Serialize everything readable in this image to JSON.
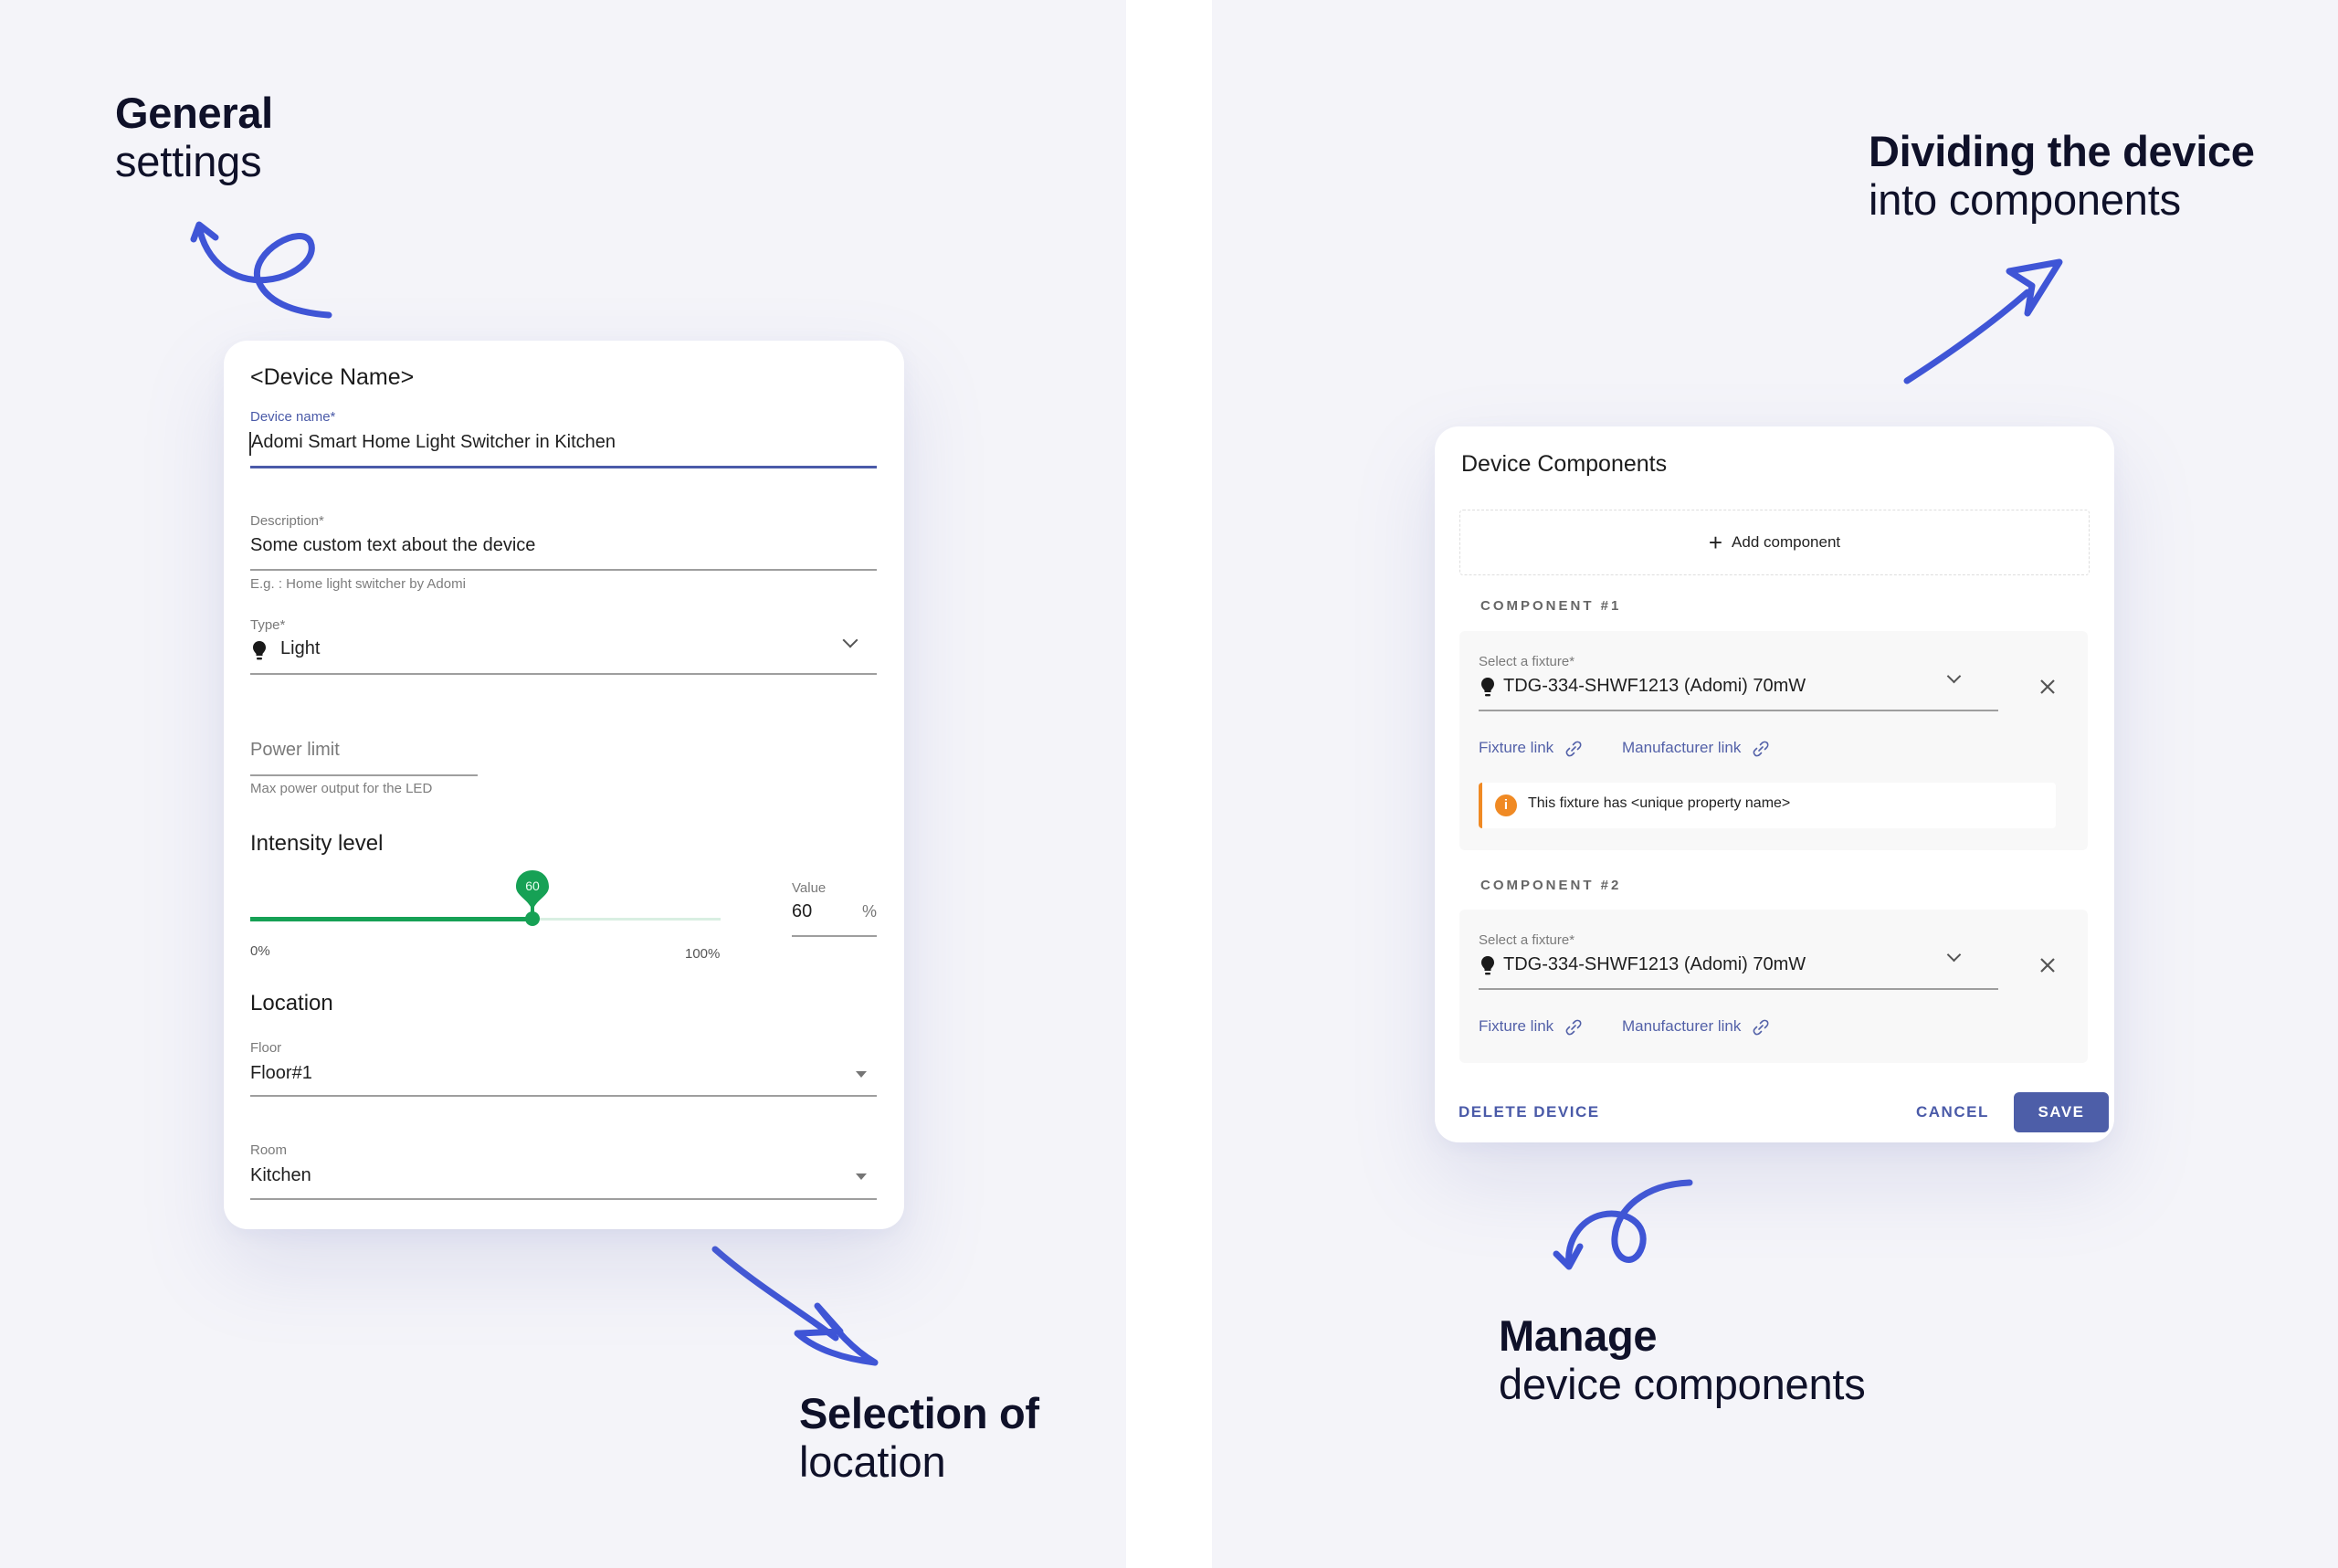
{
  "annotations": {
    "general": {
      "bold": "General",
      "regular": "settings"
    },
    "location": {
      "bold": "Selection of",
      "regular": "location"
    },
    "dividing": {
      "bold": "Dividing the device",
      "regular": "into components"
    },
    "manage": {
      "bold": "Manage",
      "regular": "device components"
    }
  },
  "colors": {
    "accent": "#4a5aa8",
    "arrow": "#3f55d6",
    "slider": "#16a155",
    "warning": "#f08a24",
    "background": "#f4f4f9"
  },
  "general_card": {
    "title": "<Device Name>",
    "device_name": {
      "label": "Device name*",
      "value": "Adomi Smart Home Light Switcher in Kitchen"
    },
    "description": {
      "label": "Description*",
      "value": "Some custom text about the device",
      "hint": "E.g. : Home light switcher by Adomi"
    },
    "type": {
      "label": "Type*",
      "value": "Light",
      "icon": "lightbulb-icon"
    },
    "power_limit": {
      "placeholder": "Power limit",
      "hint": "Max power output for the LED"
    },
    "intensity": {
      "title": "Intensity level",
      "slider_value": 60,
      "slider_min_label": "0%",
      "slider_max_label": "100%",
      "value_label": "Value",
      "value": "60",
      "unit": "%"
    },
    "location": {
      "title": "Location",
      "floor": {
        "label": "Floor",
        "value": "Floor#1"
      },
      "room": {
        "label": "Room",
        "value": "Kitchen"
      }
    }
  },
  "components_card": {
    "title": "Device Components",
    "add_label": "Add component",
    "components": [
      {
        "heading": "COMPONENT #1",
        "fixture_label": "Select a fixture*",
        "fixture_value": "TDG-334-SHWF1213 (Adomi) 70mW",
        "fixture_link": "Fixture link",
        "manufacturer_link": "Manufacturer link",
        "notice": "This fixture has <unique property name>"
      },
      {
        "heading": "COMPONENT #2",
        "fixture_label": "Select a fixture*",
        "fixture_value": "TDG-334-SHWF1213 (Adomi) 70mW",
        "fixture_link": "Fixture link",
        "manufacturer_link": "Manufacturer link"
      }
    ],
    "delete_label": "DELETE DEVICE",
    "cancel_label": "CANCEL",
    "save_label": "SAVE"
  }
}
